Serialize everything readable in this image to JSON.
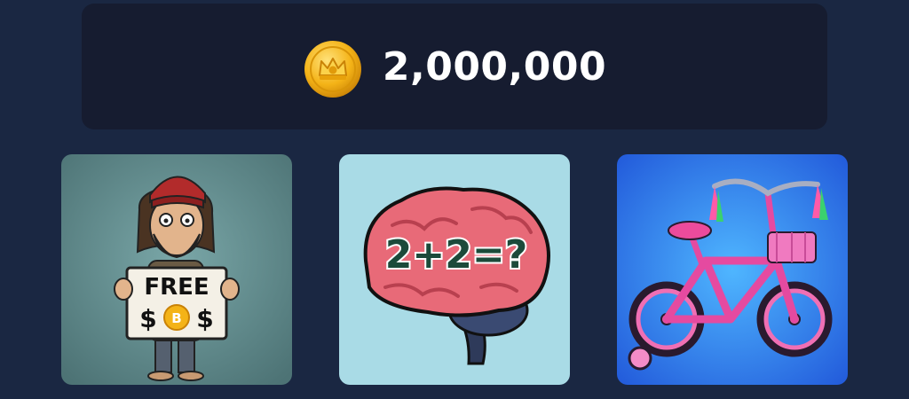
{
  "header": {
    "balance": "2,000,000",
    "coin_icon": "crown-coin-icon"
  },
  "cards": [
    {
      "id": "free-crypto",
      "sign_top": "FREE",
      "sign_bottom_left": "$",
      "sign_bottom_right": "$",
      "coin_letter": "B",
      "background": "#5f8a8c"
    },
    {
      "id": "brain-math",
      "equation": "2+2=?",
      "background": "#a9dbe6"
    },
    {
      "id": "kids-bike",
      "background": "#2f7ff0"
    }
  ],
  "colors": {
    "page_background": "#1a2742",
    "panel_background": "#161c30",
    "coin_gold": "#f4b317",
    "text": "#ffffff"
  }
}
